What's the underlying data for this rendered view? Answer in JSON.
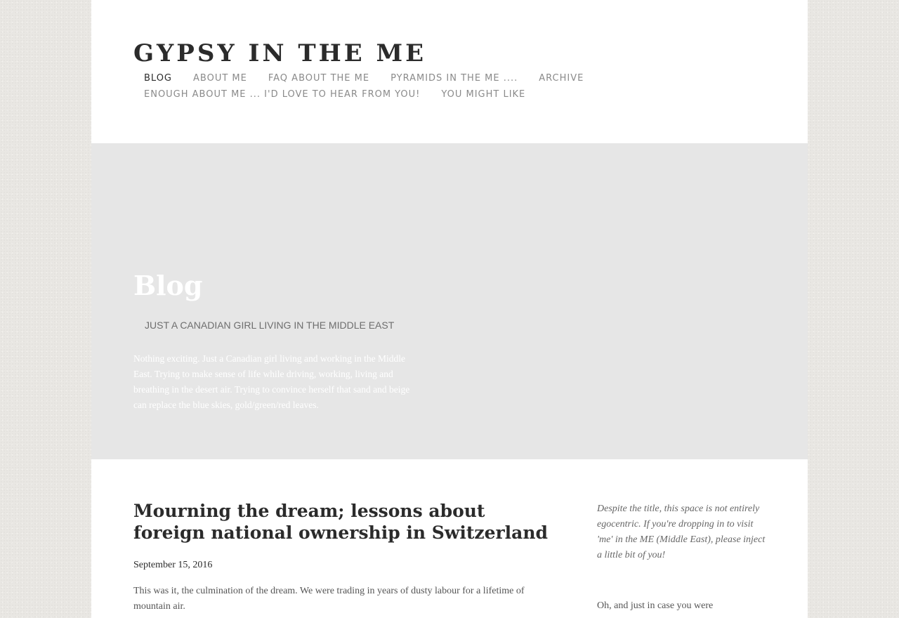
{
  "site": {
    "title": "GYPSY IN THE ME"
  },
  "nav": {
    "row1": [
      "BLOG",
      "ABOUT ME",
      "FAQ ABOUT THE ME",
      "PYRAMIDS IN THE ME ....",
      "ARCHIVE"
    ],
    "row2": [
      "ENOUGH ABOUT ME ... I'D LOVE TO HEAR FROM YOU!",
      "YOU MIGHT LIKE"
    ],
    "active": "BLOG"
  },
  "banner": {
    "title": "Blog",
    "subtitle": "JUST A CANADIAN GIRL LIVING IN THE MIDDLE EAST",
    "description": "Nothing exciting.  Just a Canadian girl living and working in the Middle East.  Trying to make sense of life while driving, working, living and breathing in the desert air.   Trying to convince herself that sand and beige can replace the blue skies, gold/green/red leaves."
  },
  "post": {
    "title": "Mourning the dream; lessons about foreign national ownership in Switzerland",
    "date": "September 15, 2016",
    "body": "This was it, the culmination of the dream. We were trading in years of dusty labour for a lifetime of mountain air."
  },
  "sidebar": {
    "intro": "Despite the title, this space is not entirely egocentric. If you're dropping in to visit 'me' in the ME (Middle East), please inject a little bit of you!",
    "more": "Oh, and just in case you were"
  }
}
